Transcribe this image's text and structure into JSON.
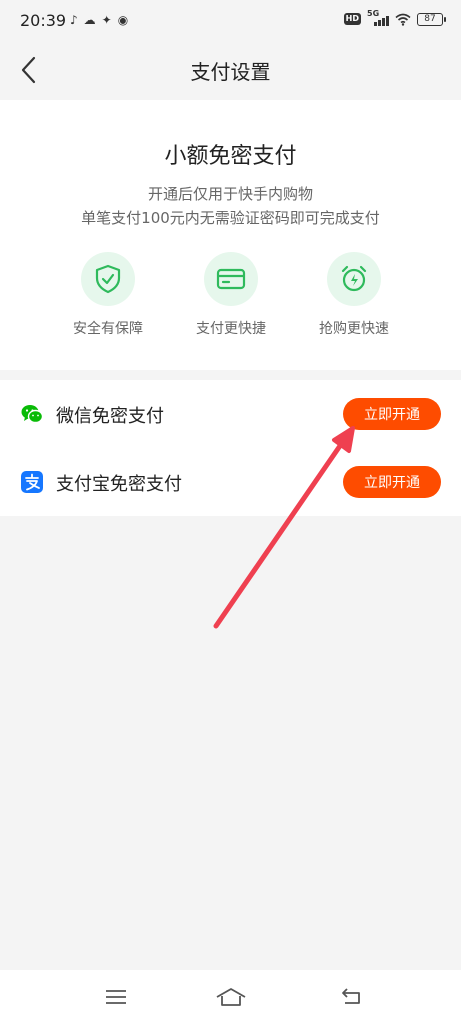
{
  "status_bar": {
    "time": "20:39",
    "left_icons": [
      "tiktok-icon",
      "cloud-icon",
      "app-icon",
      "weibo-icon"
    ],
    "hd": "HD",
    "network": "5G",
    "battery": "87"
  },
  "header": {
    "title": "支付设置"
  },
  "intro": {
    "title": "小额免密支付",
    "line1": "开通后仅用于快手内购物",
    "line2": "单笔支付100元内无需验证密码即可完成支付",
    "features": [
      {
        "label": "安全有保障",
        "icon": "shield-check-icon"
      },
      {
        "label": "支付更快捷",
        "icon": "card-icon"
      },
      {
        "label": "抢购更快速",
        "icon": "alarm-bolt-icon"
      }
    ]
  },
  "payments": [
    {
      "label": "微信免密支付",
      "button": "立即开通",
      "icon": "wechat-icon"
    },
    {
      "label": "支付宝免密支付",
      "button": "立即开通",
      "icon": "alipay-icon"
    }
  ],
  "colors": {
    "accent": "#fe4c00",
    "feature_bg": "#e6f7ec",
    "feature_icon": "#2fba5c",
    "wechat": "#09bb07",
    "alipay": "#1677ff",
    "annotation_arrow": "#ef4050"
  },
  "nav_bar": {
    "icons": [
      "menu-icon",
      "home-icon",
      "back-icon"
    ]
  }
}
